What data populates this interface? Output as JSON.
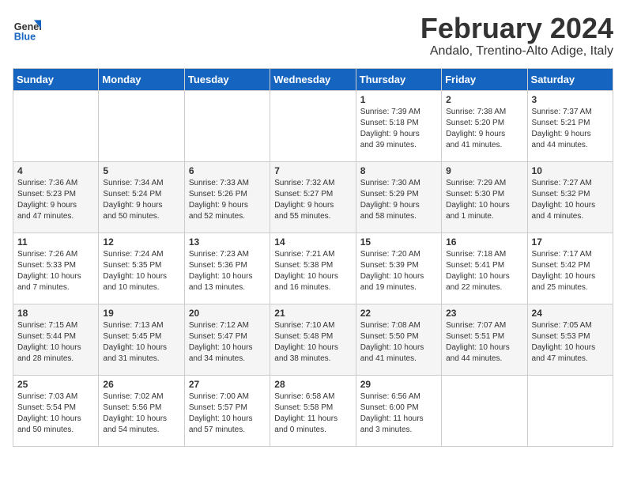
{
  "header": {
    "logo_general": "General",
    "logo_blue": "Blue",
    "title": "February 2024",
    "subtitle": "Andalo, Trentino-Alto Adige, Italy"
  },
  "days_of_week": [
    "Sunday",
    "Monday",
    "Tuesday",
    "Wednesday",
    "Thursday",
    "Friday",
    "Saturday"
  ],
  "weeks": [
    [
      {
        "day": "",
        "info": ""
      },
      {
        "day": "",
        "info": ""
      },
      {
        "day": "",
        "info": ""
      },
      {
        "day": "",
        "info": ""
      },
      {
        "day": "1",
        "info": "Sunrise: 7:39 AM\nSunset: 5:18 PM\nDaylight: 9 hours\nand 39 minutes."
      },
      {
        "day": "2",
        "info": "Sunrise: 7:38 AM\nSunset: 5:20 PM\nDaylight: 9 hours\nand 41 minutes."
      },
      {
        "day": "3",
        "info": "Sunrise: 7:37 AM\nSunset: 5:21 PM\nDaylight: 9 hours\nand 44 minutes."
      }
    ],
    [
      {
        "day": "4",
        "info": "Sunrise: 7:36 AM\nSunset: 5:23 PM\nDaylight: 9 hours\nand 47 minutes."
      },
      {
        "day": "5",
        "info": "Sunrise: 7:34 AM\nSunset: 5:24 PM\nDaylight: 9 hours\nand 50 minutes."
      },
      {
        "day": "6",
        "info": "Sunrise: 7:33 AM\nSunset: 5:26 PM\nDaylight: 9 hours\nand 52 minutes."
      },
      {
        "day": "7",
        "info": "Sunrise: 7:32 AM\nSunset: 5:27 PM\nDaylight: 9 hours\nand 55 minutes."
      },
      {
        "day": "8",
        "info": "Sunrise: 7:30 AM\nSunset: 5:29 PM\nDaylight: 9 hours\nand 58 minutes."
      },
      {
        "day": "9",
        "info": "Sunrise: 7:29 AM\nSunset: 5:30 PM\nDaylight: 10 hours\nand 1 minute."
      },
      {
        "day": "10",
        "info": "Sunrise: 7:27 AM\nSunset: 5:32 PM\nDaylight: 10 hours\nand 4 minutes."
      }
    ],
    [
      {
        "day": "11",
        "info": "Sunrise: 7:26 AM\nSunset: 5:33 PM\nDaylight: 10 hours\nand 7 minutes."
      },
      {
        "day": "12",
        "info": "Sunrise: 7:24 AM\nSunset: 5:35 PM\nDaylight: 10 hours\nand 10 minutes."
      },
      {
        "day": "13",
        "info": "Sunrise: 7:23 AM\nSunset: 5:36 PM\nDaylight: 10 hours\nand 13 minutes."
      },
      {
        "day": "14",
        "info": "Sunrise: 7:21 AM\nSunset: 5:38 PM\nDaylight: 10 hours\nand 16 minutes."
      },
      {
        "day": "15",
        "info": "Sunrise: 7:20 AM\nSunset: 5:39 PM\nDaylight: 10 hours\nand 19 minutes."
      },
      {
        "day": "16",
        "info": "Sunrise: 7:18 AM\nSunset: 5:41 PM\nDaylight: 10 hours\nand 22 minutes."
      },
      {
        "day": "17",
        "info": "Sunrise: 7:17 AM\nSunset: 5:42 PM\nDaylight: 10 hours\nand 25 minutes."
      }
    ],
    [
      {
        "day": "18",
        "info": "Sunrise: 7:15 AM\nSunset: 5:44 PM\nDaylight: 10 hours\nand 28 minutes."
      },
      {
        "day": "19",
        "info": "Sunrise: 7:13 AM\nSunset: 5:45 PM\nDaylight: 10 hours\nand 31 minutes."
      },
      {
        "day": "20",
        "info": "Sunrise: 7:12 AM\nSunset: 5:47 PM\nDaylight: 10 hours\nand 34 minutes."
      },
      {
        "day": "21",
        "info": "Sunrise: 7:10 AM\nSunset: 5:48 PM\nDaylight: 10 hours\nand 38 minutes."
      },
      {
        "day": "22",
        "info": "Sunrise: 7:08 AM\nSunset: 5:50 PM\nDaylight: 10 hours\nand 41 minutes."
      },
      {
        "day": "23",
        "info": "Sunrise: 7:07 AM\nSunset: 5:51 PM\nDaylight: 10 hours\nand 44 minutes."
      },
      {
        "day": "24",
        "info": "Sunrise: 7:05 AM\nSunset: 5:53 PM\nDaylight: 10 hours\nand 47 minutes."
      }
    ],
    [
      {
        "day": "25",
        "info": "Sunrise: 7:03 AM\nSunset: 5:54 PM\nDaylight: 10 hours\nand 50 minutes."
      },
      {
        "day": "26",
        "info": "Sunrise: 7:02 AM\nSunset: 5:56 PM\nDaylight: 10 hours\nand 54 minutes."
      },
      {
        "day": "27",
        "info": "Sunrise: 7:00 AM\nSunset: 5:57 PM\nDaylight: 10 hours\nand 57 minutes."
      },
      {
        "day": "28",
        "info": "Sunrise: 6:58 AM\nSunset: 5:58 PM\nDaylight: 11 hours\nand 0 minutes."
      },
      {
        "day": "29",
        "info": "Sunrise: 6:56 AM\nSunset: 6:00 PM\nDaylight: 11 hours\nand 3 minutes."
      },
      {
        "day": "",
        "info": ""
      },
      {
        "day": "",
        "info": ""
      }
    ]
  ]
}
